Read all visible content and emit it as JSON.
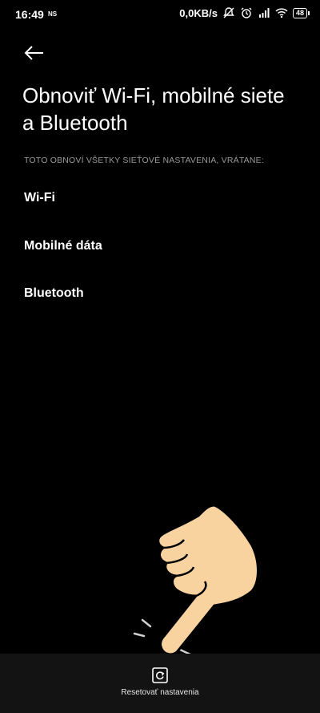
{
  "status_bar": {
    "time": "16:49",
    "carrier_badge": "NS",
    "net_speed": "0,0KB/s",
    "battery": "48"
  },
  "header": {
    "title": "Obnoviť Wi‑Fi, mobilné siete a Bluetooth"
  },
  "section": {
    "caption": "TOTO OBNOVÍ VŠETKY SIEŤOVÉ NASTAVENIA, VRÁTANE:",
    "items": [
      {
        "label": "Wi‑Fi"
      },
      {
        "label": "Mobilné dáta"
      },
      {
        "label": "Bluetooth"
      }
    ]
  },
  "bottom_bar": {
    "reset_label": "Resetovať nastavenia"
  },
  "icons": {
    "back": "arrow-left-icon",
    "reset": "reset-icon",
    "pointer": "pointing-hand-icon"
  },
  "colors": {
    "background": "#000000",
    "bottom_bar": "#131313",
    "caption": "#9a9a9a",
    "hand_fill": "#f8d3a0"
  }
}
